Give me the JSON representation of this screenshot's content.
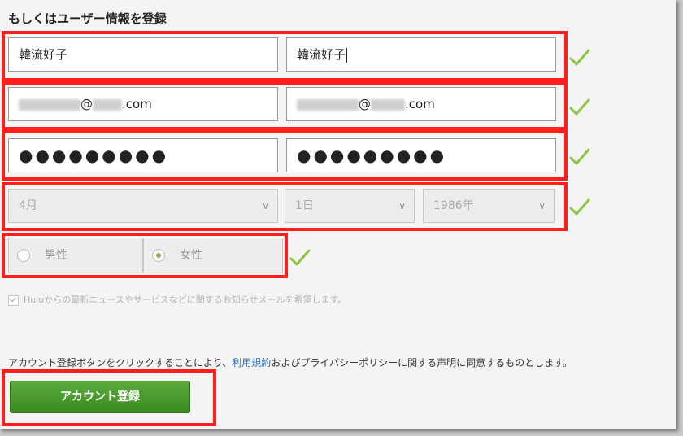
{
  "section_title": "もしくはユーザー情報を登録",
  "name_row": {
    "first_value": "韓流好子",
    "second_value": "韓流好子"
  },
  "email_row": {
    "first_suffix": "@",
    "first_domain_end": ".com",
    "second_suffix": "@",
    "second_domain_end": ".com"
  },
  "password_row": {
    "first_value": "●●●●●●●●●",
    "second_value": "●●●●●●●●●"
  },
  "birthday": {
    "month": "4月",
    "day": "1日",
    "year": "1986年"
  },
  "gender": {
    "male_label": "男性",
    "female_label": "女性",
    "selected": "female"
  },
  "newsletter_label": "Huluからの最新ニュースやサービスなどに関するお知らせメールを希望します。",
  "terms": {
    "before": "アカウント登録ボタンをクリックすることにより、",
    "link": "利用規約",
    "after": "およびプライバシーポリシーに関する声明に同意するものとします。"
  },
  "submit_label": "アカウント登録",
  "colors": {
    "highlight": "#ff1e1e",
    "check": "#8cc63f",
    "button": "#4a9a2e",
    "link": "#2a6fb8"
  }
}
